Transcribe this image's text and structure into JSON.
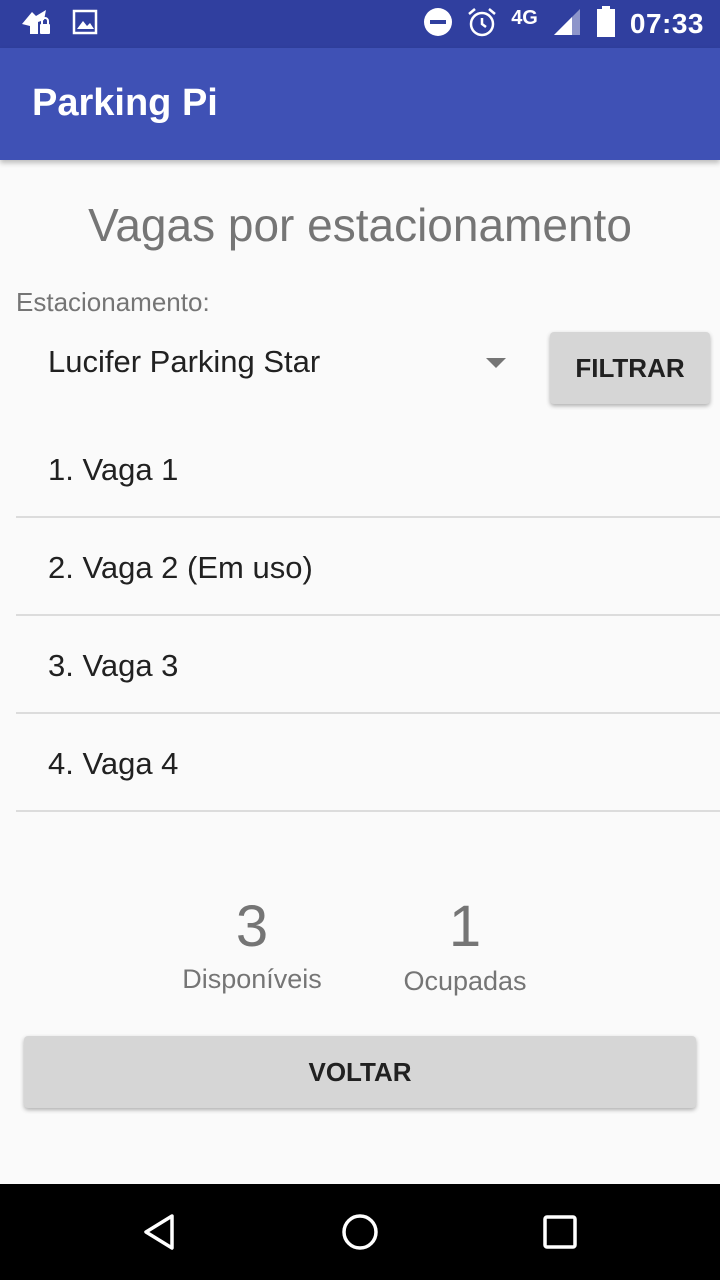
{
  "status_bar": {
    "network": "4G",
    "time": "07:33",
    "icons": [
      "notification-app-icon",
      "image-icon",
      "do-not-disturb-icon",
      "alarm-icon",
      "signal-icon",
      "battery-icon"
    ]
  },
  "app_bar": {
    "title": "Parking Pi"
  },
  "main": {
    "title": "Vagas por estacionamento",
    "field_label": "Estacionamento:",
    "spinner_value": "Lucifer Parking Star",
    "filter_button": "FILTRAR",
    "spots": [
      {
        "label": "1. Vaga 1"
      },
      {
        "label": "2. Vaga 2 (Em uso)"
      },
      {
        "label": "3. Vaga 3"
      },
      {
        "label": "4. Vaga 4"
      }
    ],
    "stats": {
      "available": {
        "value": "3",
        "label": "Disponíveis"
      },
      "occupied": {
        "value": "1",
        "label": "Ocupadas"
      }
    },
    "back_button": "VOLTAR"
  },
  "colors": {
    "status_bar": "#303f9f",
    "app_bar": "#3f51b5",
    "background": "#fafafa",
    "button": "#d6d6d6"
  }
}
